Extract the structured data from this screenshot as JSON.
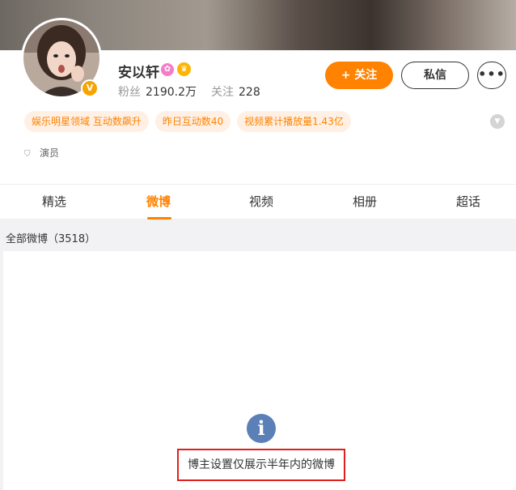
{
  "profile": {
    "name": "安以轩",
    "verified_badge": "V",
    "badges": {
      "vip_icon": "vip-badge-icon",
      "crown_icon": "crown-badge-icon"
    },
    "followers_label": "粉丝",
    "followers_value": "2190.2万",
    "following_label": "关注",
    "following_value": "228",
    "role": "演员"
  },
  "actions": {
    "follow_label": "关注",
    "follow_icon": "+",
    "message_label": "私信",
    "more_label": "•••"
  },
  "tags": [
    "娱乐明星领域 互动数飙升",
    "昨日互动数40",
    "视频累计播放量1.43亿"
  ],
  "tabs": [
    "精选",
    "微博",
    "视频",
    "相册",
    "超话"
  ],
  "active_tab": "微博",
  "feed": {
    "count_label": "全部微博（3518）",
    "notice": "博主设置仅展示半年内的微博",
    "info_icon": "i"
  },
  "colors": {
    "accent": "#ff8200",
    "tag_bg": "#fff0e5",
    "info_icon": "#5b7fb7",
    "highlight_border": "#e02020",
    "verified": "#f7a400"
  }
}
